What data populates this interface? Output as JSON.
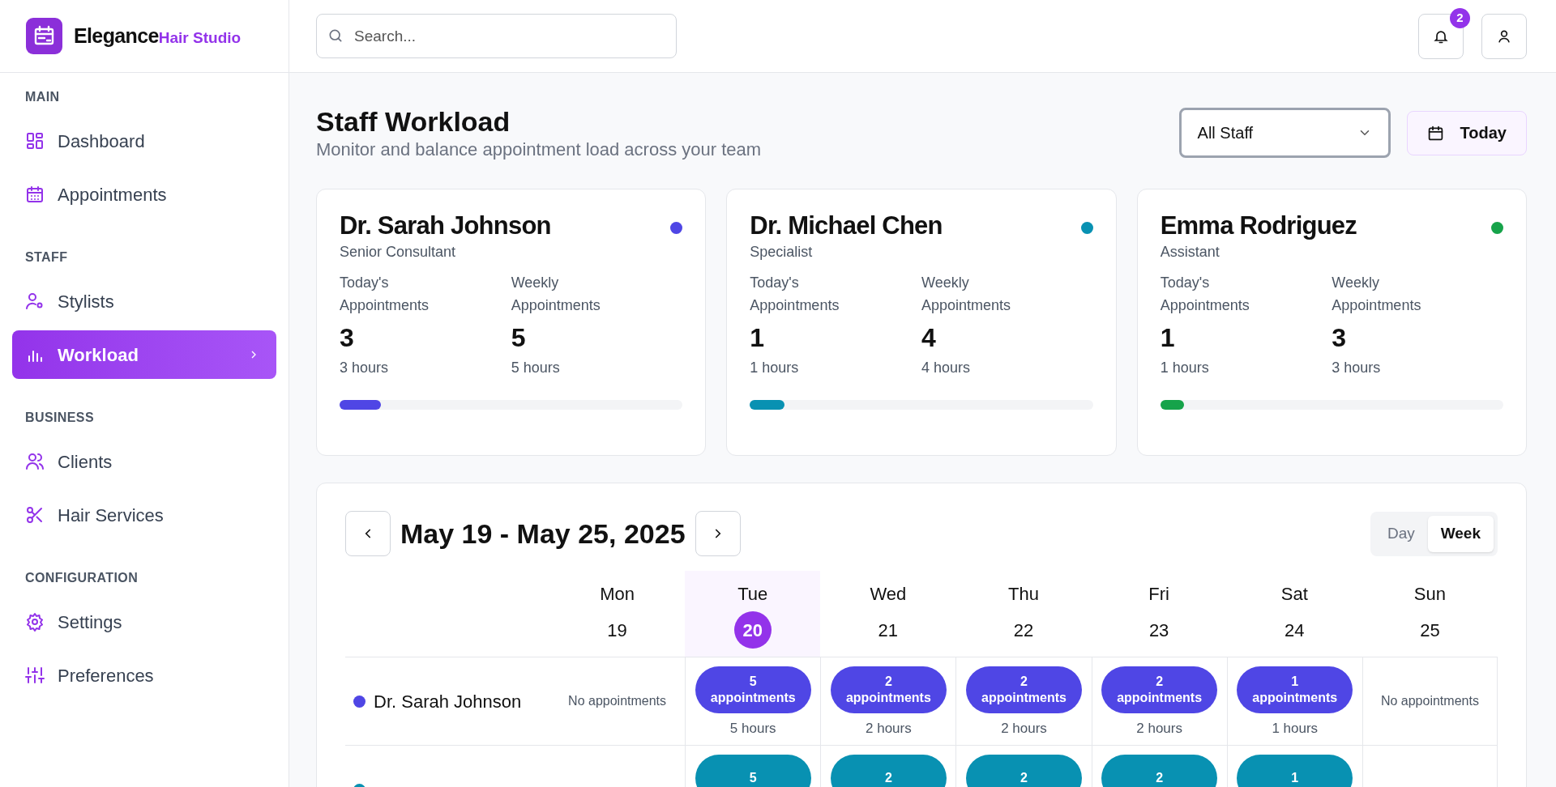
{
  "brand": {
    "name": "Elegance",
    "tagline": "Hair Studio"
  },
  "sidebar": {
    "sections": [
      {
        "label": "MAIN",
        "items": [
          {
            "label": "Dashboard",
            "selected": false
          },
          {
            "label": "Appointments",
            "selected": false
          }
        ]
      },
      {
        "label": "STAFF",
        "items": [
          {
            "label": "Stylists",
            "selected": false
          },
          {
            "label": "Workload",
            "selected": true
          }
        ]
      },
      {
        "label": "BUSINESS",
        "items": [
          {
            "label": "Clients",
            "selected": false
          },
          {
            "label": "Hair Services",
            "selected": false
          }
        ]
      },
      {
        "label": "CONFIGURATION",
        "items": [
          {
            "label": "Settings",
            "selected": false
          },
          {
            "label": "Preferences",
            "selected": false
          }
        ]
      }
    ]
  },
  "header": {
    "search": {
      "placeholder": "Search..."
    },
    "notifications": {
      "count": "2"
    }
  },
  "page": {
    "title": "Staff Workload",
    "subtitle": "Monitor and balance appointment load across your team",
    "staff_filter": "All Staff",
    "today_button": "Today"
  },
  "staff_cards": [
    {
      "name": "Dr. Sarah Johnson",
      "role": "Senior Consultant",
      "color": "#4f46e5",
      "today_label": "Today's Appointments",
      "today_count": "3",
      "today_hours": "3 hours",
      "weekly_label": "Weekly Appointments",
      "weekly_count": "5",
      "weekly_hours": "5 hours",
      "level": 0.12
    },
    {
      "name": "Dr. Michael Chen",
      "role": "Specialist",
      "color": "#0891b2",
      "today_label": "Today's Appointments",
      "today_count": "1",
      "today_hours": "1 hours",
      "weekly_label": "Weekly Appointments",
      "weekly_count": "4",
      "weekly_hours": "4 hours",
      "level": 0.1
    },
    {
      "name": "Emma Rodriguez",
      "role": "Assistant",
      "color": "#16a34a",
      "today_label": "Today's Appointments",
      "today_count": "1",
      "today_hours": "1 hours",
      "weekly_label": "Weekly Appointments",
      "weekly_count": "3",
      "weekly_hours": "3 hours",
      "level": 0.07
    }
  ],
  "calendar": {
    "range": "May 19 - May 25, 2025",
    "view_toggle": [
      {
        "label": "Day",
        "selected": false
      },
      {
        "label": "Week",
        "selected": true
      }
    ],
    "days": [
      {
        "name": "Mon",
        "date": "19",
        "selected": false
      },
      {
        "name": "Tue",
        "date": "20",
        "selected": true
      },
      {
        "name": "Wed",
        "date": "21",
        "selected": false
      },
      {
        "name": "Thu",
        "date": "22",
        "selected": false
      },
      {
        "name": "Fri",
        "date": "23",
        "selected": false
      },
      {
        "name": "Sat",
        "date": "24",
        "selected": false
      },
      {
        "name": "Sun",
        "date": "25",
        "selected": false
      }
    ],
    "rows": [
      {
        "name": "Dr. Sarah Johnson",
        "color": "#4f46e5",
        "cells": [
          {
            "kind": "empty",
            "text": "No appointments"
          },
          {
            "kind": "booked",
            "text": "5 appointments",
            "hours": "5 hours"
          },
          {
            "kind": "booked",
            "text": "2 appointments",
            "hours": "2 hours"
          },
          {
            "kind": "booked",
            "text": "2 appointments",
            "hours": "2 hours"
          },
          {
            "kind": "booked",
            "text": "2 appointments",
            "hours": "2 hours"
          },
          {
            "kind": "booked",
            "text": "1 appointments",
            "hours": "1 hours"
          },
          {
            "kind": "empty",
            "text": "No appointments"
          }
        ]
      },
      {
        "color": "#0891b2",
        "cells": [
          {
            "kind": "empty"
          },
          {
            "kind": "booked",
            "text": "5"
          },
          {
            "kind": "booked",
            "text": "2"
          },
          {
            "kind": "booked",
            "text": "2"
          },
          {
            "kind": "booked",
            "text": "2"
          },
          {
            "kind": "booked",
            "text": "1"
          },
          {
            "kind": "empty"
          }
        ]
      }
    ]
  }
}
